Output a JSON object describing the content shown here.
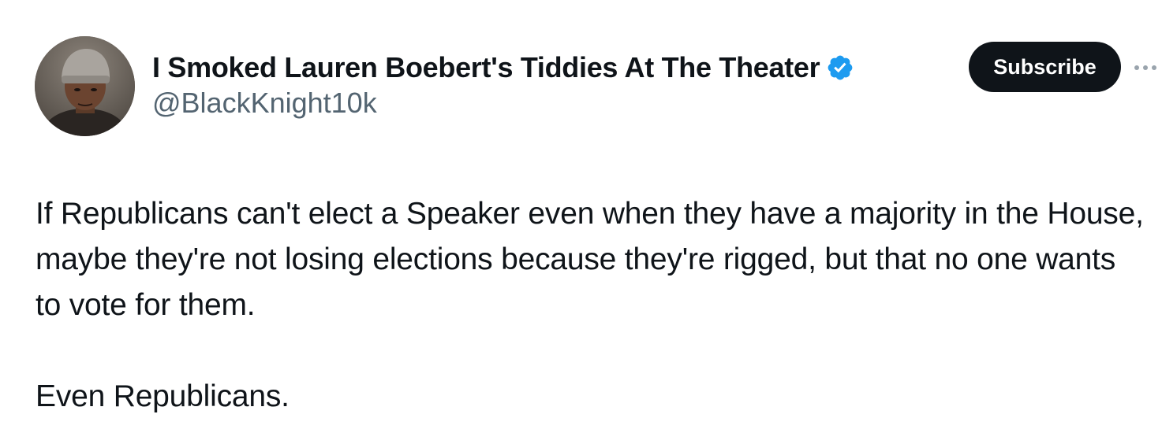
{
  "author": {
    "display_name": "I Smoked Lauren Boebert's Tiddies At The Theater",
    "handle": "@BlackKnight10k",
    "verified": true,
    "verified_badge_color": "#1d9bf0",
    "avatar_icon": "user-avatar-photo"
  },
  "actions": {
    "subscribe_label": "Subscribe",
    "more_icon": "more-horizontal-icon"
  },
  "tweet": {
    "paragraphs": [
      "If Republicans can't elect a Speaker even when they have a majority in the House, maybe they're not losing elections because they're rigged, but that no one wants to vote for them.",
      "Even Republicans."
    ]
  },
  "colors": {
    "text": "#0f1419",
    "secondary_text": "#536471",
    "button_bg": "#0f1419",
    "button_text": "#ffffff"
  }
}
